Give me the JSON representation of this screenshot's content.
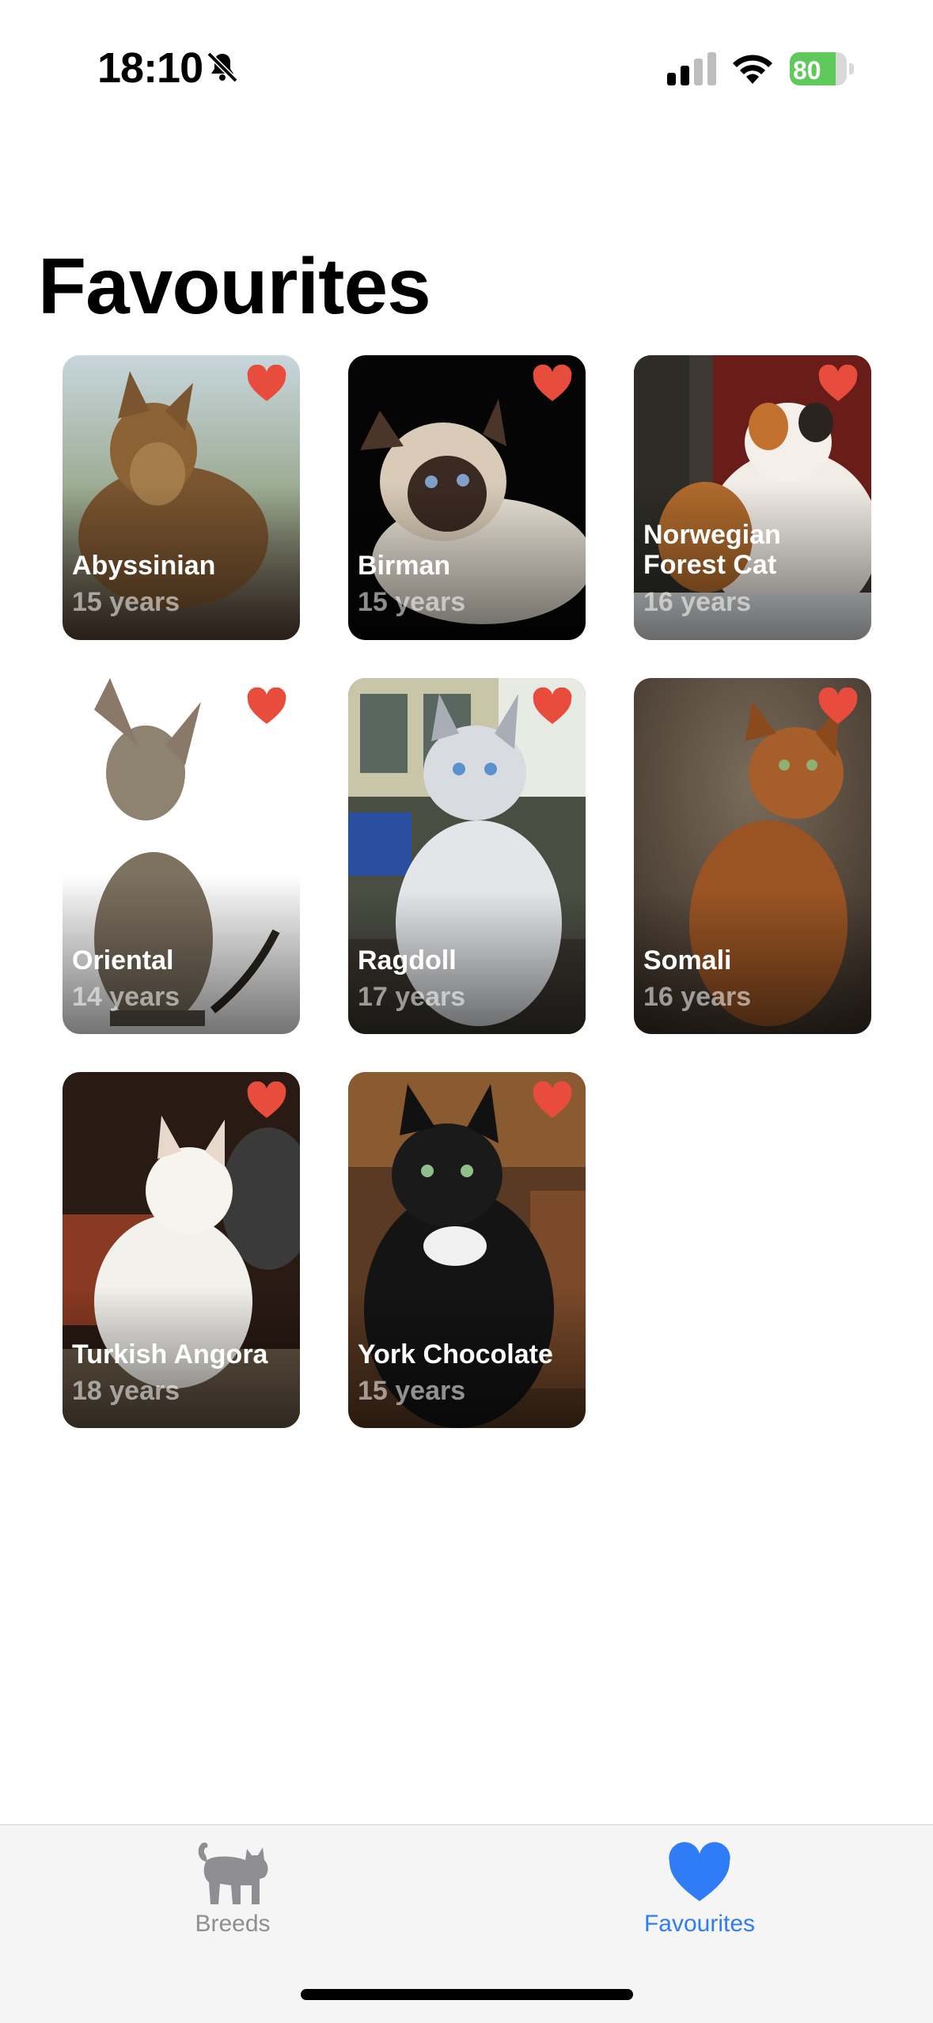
{
  "status_bar": {
    "time": "18:10",
    "battery_percent": "80"
  },
  "page": {
    "title": "Favourites"
  },
  "favourites": [
    {
      "name": "Abyssinian",
      "age": "15 years"
    },
    {
      "name": "Birman",
      "age": "15 years"
    },
    {
      "name": "Norwegian Forest Cat",
      "age": "16 years"
    },
    {
      "name": "Oriental",
      "age": "14 years"
    },
    {
      "name": "Ragdoll",
      "age": "17 years"
    },
    {
      "name": "Somali",
      "age": "16 years"
    },
    {
      "name": "Turkish Angora",
      "age": "18 years"
    },
    {
      "name": "York Chocolate",
      "age": "15 years"
    }
  ],
  "tab_bar": {
    "breeds_label": "Breeds",
    "favourites_label": "Favourites",
    "active_tab": "favourites"
  },
  "colors": {
    "heart": "#e74c3c",
    "accent": "#2f7cf6",
    "inactive": "#8e8e93"
  },
  "icons": {
    "breeds_tab": "cat-icon",
    "favourites_tab": "heart-icon",
    "card_favourite": "heart-icon"
  }
}
